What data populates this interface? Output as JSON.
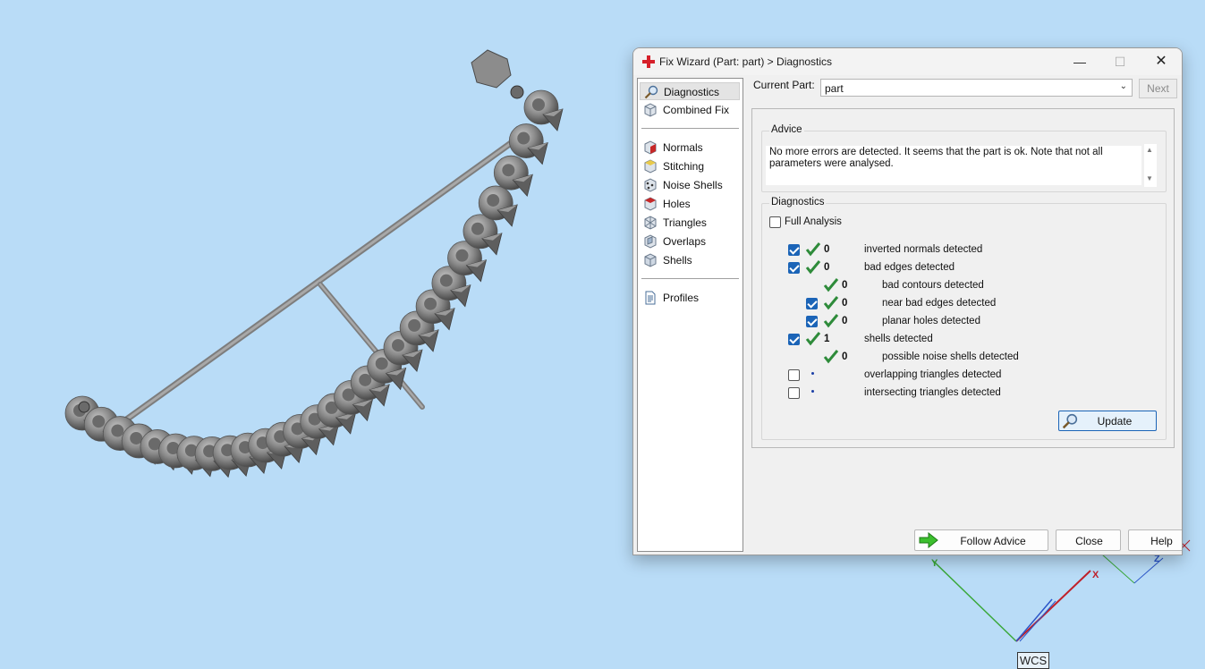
{
  "viewport": {
    "wcs_label": "WCS",
    "axis_x": "X",
    "axis_y": "Y",
    "axis_z": "Z"
  },
  "dialog": {
    "title": "Fix Wizard (Part: part) > Diagnostics",
    "nav": {
      "group1": [
        {
          "label": "Diagnostics",
          "icon": "magnifier-icon",
          "selected": true
        },
        {
          "label": "Combined Fix",
          "icon": "cube-icon"
        }
      ],
      "group2": [
        {
          "label": "Normals",
          "icon": "normals-cube-icon"
        },
        {
          "label": "Stitching",
          "icon": "stitching-cube-icon"
        },
        {
          "label": "Noise Shells",
          "icon": "noise-shells-icon"
        },
        {
          "label": "Holes",
          "icon": "holes-cube-icon"
        },
        {
          "label": "Triangles",
          "icon": "triangles-icon"
        },
        {
          "label": "Overlaps",
          "icon": "overlaps-cube-icon"
        },
        {
          "label": "Shells",
          "icon": "shells-cube-icon"
        }
      ],
      "group3": [
        {
          "label": "Profiles",
          "icon": "document-icon"
        }
      ]
    },
    "current_part_label": "Current Part:",
    "current_part_value": "part",
    "next_label": "Next",
    "advice": {
      "title": "Advice",
      "text": "No more errors are detected. It seems that the part is ok. Note that not all parameters were analysed."
    },
    "diagnostics": {
      "title": "Diagnostics",
      "full_analysis_label": "Full Analysis",
      "full_analysis_checked": false,
      "rows": [
        {
          "checkbox": true,
          "checked": true,
          "status": "ok",
          "count": "0",
          "label": "inverted normals detected",
          "indent": 0
        },
        {
          "checkbox": true,
          "checked": true,
          "status": "ok",
          "count": "0",
          "label": "bad edges detected",
          "indent": 0
        },
        {
          "checkbox": false,
          "checked": false,
          "status": "ok",
          "count": "0",
          "label": "bad contours detected",
          "indent": 1
        },
        {
          "checkbox": true,
          "checked": true,
          "status": "ok",
          "count": "0",
          "label": "near bad edges detected",
          "indent": 1
        },
        {
          "checkbox": true,
          "checked": true,
          "status": "ok",
          "count": "0",
          "label": "planar holes detected",
          "indent": 1
        },
        {
          "checkbox": true,
          "checked": true,
          "status": "ok",
          "count": "1",
          "label": "shells detected",
          "indent": 0
        },
        {
          "checkbox": false,
          "checked": false,
          "status": "ok",
          "count": "0",
          "label": "possible noise shells detected",
          "indent": 1
        },
        {
          "checkbox": true,
          "checked": false,
          "status": "pending",
          "count": "",
          "label": "overlapping triangles detected",
          "indent": 0
        },
        {
          "checkbox": true,
          "checked": false,
          "status": "pending",
          "count": "",
          "label": "intersecting triangles detected",
          "indent": 0
        }
      ],
      "update_label": "Update"
    },
    "buttons": {
      "follow_advice": "Follow Advice",
      "close": "Close",
      "help": "Help"
    }
  },
  "colors": {
    "background": "#b9dcf7",
    "accent": "#1b64b7",
    "ok_tick": "#2e8b3a"
  }
}
